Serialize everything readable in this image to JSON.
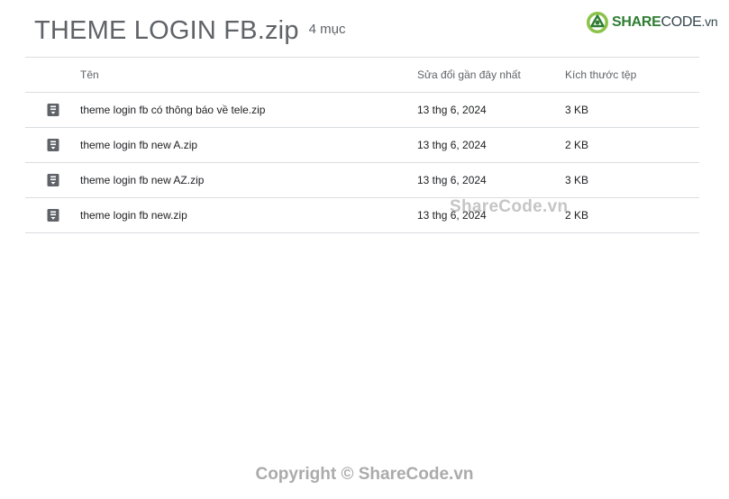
{
  "header": {
    "title": "THEME LOGIN FB.zip",
    "item_count": "4 mục"
  },
  "logo": {
    "brand": "SHARECODE.vn",
    "icon": "sharecode-logo-icon",
    "colors": {
      "primary": "#2e7d32",
      "accent": "#8bc34a"
    }
  },
  "table": {
    "columns": {
      "name": "Tên",
      "modified": "Sửa đổi gần đây nhất",
      "size": "Kích thước tệp"
    },
    "rows": [
      {
        "icon": "zip-file-icon",
        "name": "theme login fb có thông báo về tele.zip",
        "modified": "13 thg 6, 2024",
        "size": "3 KB"
      },
      {
        "icon": "zip-file-icon",
        "name": "theme login fb new A.zip",
        "modified": "13 thg 6, 2024",
        "size": "2 KB"
      },
      {
        "icon": "zip-file-icon",
        "name": "theme login fb new AZ.zip",
        "modified": "13 thg 6, 2024",
        "size": "3 KB"
      },
      {
        "icon": "zip-file-icon",
        "name": "theme login fb new.zip",
        "modified": "13 thg 6, 2024",
        "size": "2 KB"
      }
    ]
  },
  "watermark": "ShareCode.vn",
  "copyright": "Copyright © ShareCode.vn"
}
